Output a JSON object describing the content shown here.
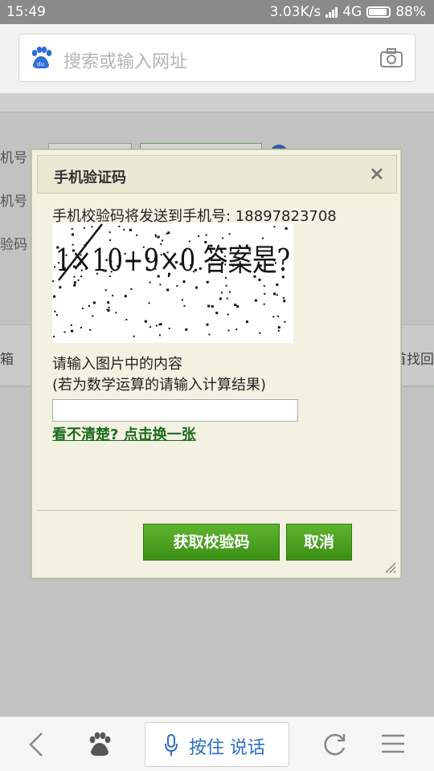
{
  "status_bar": {
    "time": "15:49",
    "network_speed": "3.03K/s",
    "network_type": "4G",
    "battery": "88%"
  },
  "search": {
    "placeholder": "搜索或输入网址",
    "logo_icon": "baidu-paw-icon",
    "camera_icon": "camera-icon"
  },
  "background": {
    "labels": [
      "机号",
      "机号",
      "验码"
    ],
    "strip_left": "箱",
    "strip_right": "首找回"
  },
  "dialog": {
    "title": "手机验证码",
    "close": "×",
    "send_notice": "手机校验码将发送到手机号: 18897823708",
    "captcha_text": "1×10+9×0 答案是?",
    "prompt": "请输入图片中的内容",
    "prompt_hint": "(若为数学运算的请输入计算结果)",
    "input_value": "",
    "refresh_link": "看不清楚? 点击换一张",
    "get_code_button": "获取校验码",
    "cancel_button": "取消"
  },
  "toolbar": {
    "voice_label": "按住 说话"
  },
  "colors": {
    "button_green": "#4ba321",
    "link_green": "#1d6b1d",
    "voice_blue": "#2b6ec5",
    "dialog_bg": "#f3f1e2"
  }
}
